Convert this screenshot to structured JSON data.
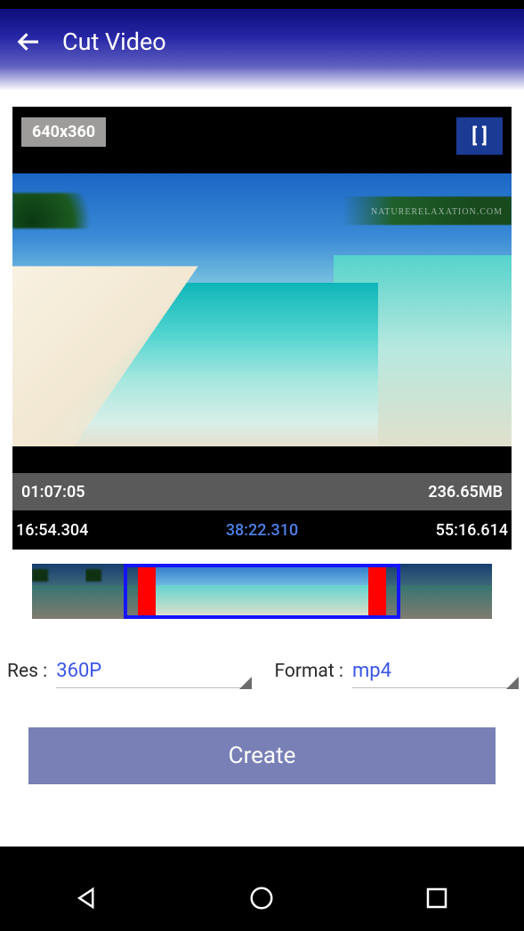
{
  "appbar": {
    "title": "Cut Video"
  },
  "preview": {
    "resolution_badge": "640x360",
    "crop_button": "[  ]",
    "watermark": "NATURERELAXATION.COM"
  },
  "info": {
    "duration": "01:07:05",
    "filesize": "236.65MB"
  },
  "timecodes": {
    "start": "16:54.304",
    "current": "38:22.310",
    "end": "55:16.614"
  },
  "options": {
    "res_label": "Res :",
    "res_value": "360P",
    "format_label": "Format :",
    "format_value": "mp4"
  },
  "actions": {
    "create": "Create"
  }
}
